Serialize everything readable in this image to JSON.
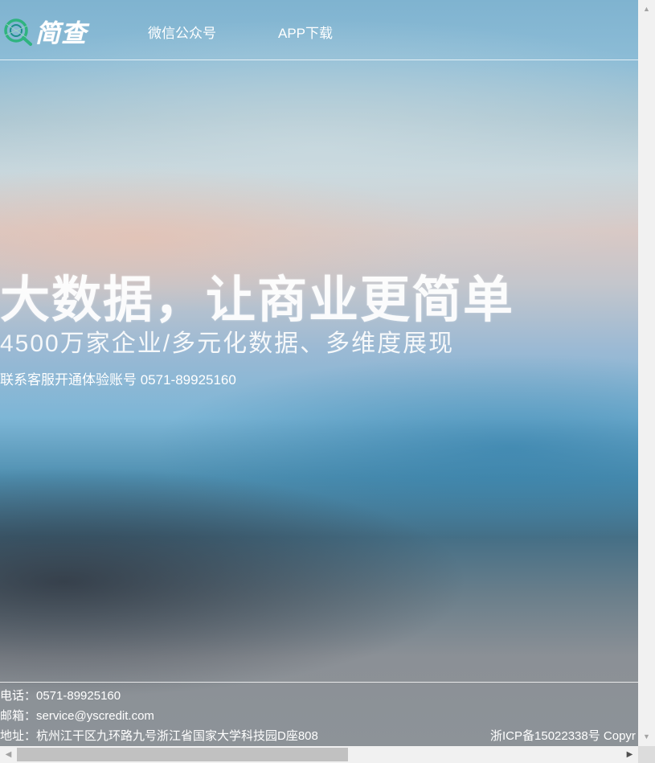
{
  "header": {
    "logo_text": "简查",
    "nav": [
      {
        "label": "微信公众号"
      },
      {
        "label": "APP下载"
      }
    ]
  },
  "hero": {
    "title": "大数据，让商业更简单",
    "subtitle": "4500万家企业/多元化数据、多维度展现",
    "contact": "联系客服开通体验账号 0571-89925160"
  },
  "footer": {
    "phone": "电话：0571-89925160",
    "email": "邮箱：service@yscredit.com",
    "address": "地址：杭州江干区九环路九号浙江省国家大学科技园D座808",
    "icp": "浙ICP备15022338号 Copyr"
  },
  "scrollbars": {
    "up_icon": "arrow-up-icon",
    "down_icon": "arrow-down-icon",
    "left_icon": "arrow-left-icon",
    "right_icon": "arrow-right-icon"
  },
  "colors": {
    "text": "#ffffff",
    "logo_accent": "#2fb37f",
    "scrollbar_track": "#f1f1f1",
    "scrollbar_thumb": "#c1c1c1"
  }
}
